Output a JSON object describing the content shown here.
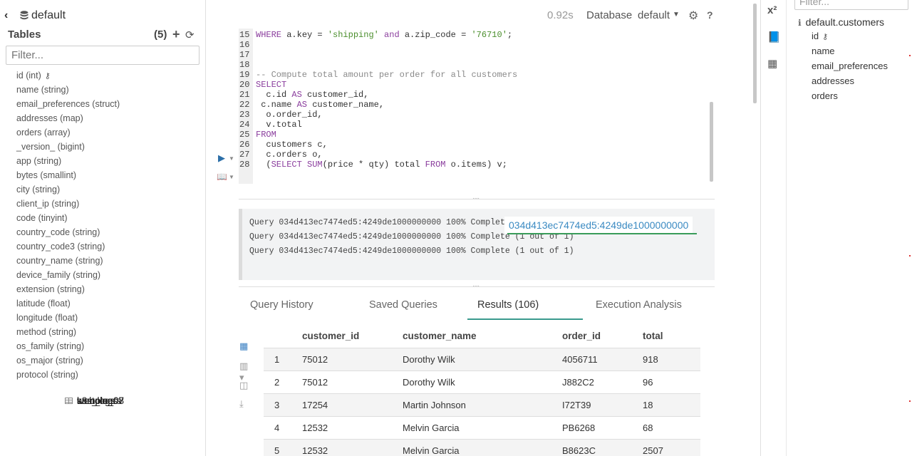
{
  "left": {
    "database": "default",
    "tables_label": "Tables",
    "tables_count": "(5)",
    "filter_placeholder": "Filter...",
    "tables": [
      {
        "name": "customers",
        "columns": [
          {
            "label": "id (int)",
            "key": true
          },
          {
            "label": "name (string)"
          },
          {
            "label": "email_preferences (struct)"
          },
          {
            "label": "addresses (map)"
          },
          {
            "label": "orders (array)"
          }
        ]
      },
      {
        "name": "k8s_logs",
        "columns": []
      },
      {
        "name": "sample_07",
        "columns": []
      },
      {
        "name": "sample_08",
        "columns": []
      },
      {
        "name": "web_logs",
        "columns": [
          {
            "label": "_version_ (bigint)"
          },
          {
            "label": "app (string)"
          },
          {
            "label": "bytes (smallint)"
          },
          {
            "label": "city (string)"
          },
          {
            "label": "client_ip (string)"
          },
          {
            "label": "code (tinyint)"
          },
          {
            "label": "country_code (string)"
          },
          {
            "label": "country_code3 (string)"
          },
          {
            "label": "country_name (string)"
          },
          {
            "label": "device_family (string)"
          },
          {
            "label": "extension (string)"
          },
          {
            "label": "latitude (float)"
          },
          {
            "label": "longitude (float)"
          },
          {
            "label": "method (string)"
          },
          {
            "label": "os_family (string)"
          },
          {
            "label": "os_major (string)"
          },
          {
            "label": "protocol (string)"
          }
        ]
      }
    ]
  },
  "topbar": {
    "time": "0.92s",
    "database_label": "Database",
    "database_value": "default"
  },
  "editor": {
    "lines": [
      {
        "n": "15",
        "html": "<span class=\"kw\">WHERE</span> a.key = <span class=\"str\">'shipping'</span> <span class=\"kw\">and</span> a.zip_code = <span class=\"str\">'76710'</span>;"
      },
      {
        "n": "16",
        "html": ""
      },
      {
        "n": "17",
        "html": ""
      },
      {
        "n": "18",
        "html": ""
      },
      {
        "n": "19",
        "html": "<span class=\"cm\">-- Compute total amount per order for all customers</span>"
      },
      {
        "n": "20",
        "html": "<span class=\"kw\">SELECT</span>"
      },
      {
        "n": "21",
        "html": "  c.id <span class=\"kw\">AS</span> customer_id,"
      },
      {
        "n": "22",
        "html": " c.name <span class=\"kw\">AS</span> customer_name,"
      },
      {
        "n": "23",
        "html": "  o.order_id,"
      },
      {
        "n": "24",
        "html": "  v.total"
      },
      {
        "n": "25",
        "html": "<span class=\"kw\">FROM</span>"
      },
      {
        "n": "26",
        "html": "  customers c,"
      },
      {
        "n": "27",
        "html": "  c.orders o,"
      },
      {
        "n": "28",
        "html": "  (<span class=\"kw\">SELECT</span> <span class=\"kw\">SUM</span>(price * qty) total <span class=\"kw\">FROM</span> o.items) v;"
      }
    ]
  },
  "log": {
    "lines": [
      "Query 034d413ec7474ed5:4249de1000000000 100% Complete (1 out of 1)",
      "Query 034d413ec7474ed5:4249de1000000000 100% Complete (1 out of 1)",
      "Query 034d413ec7474ed5:4249de1000000000 100% Complete (1 out of 1)"
    ],
    "tooltip": "034d413ec7474ed5:4249de1000000000"
  },
  "tabs": [
    {
      "label": "Query History",
      "active": false
    },
    {
      "label": "Saved Queries",
      "active": false
    },
    {
      "label": "Results (106)",
      "active": true
    },
    {
      "label": "Execution Analysis",
      "active": false
    }
  ],
  "results": {
    "headers": [
      "",
      "customer_id",
      "customer_name",
      "order_id",
      "total"
    ],
    "rows": [
      [
        "1",
        "75012",
        "Dorothy Wilk",
        "4056711",
        "918"
      ],
      [
        "2",
        "75012",
        "Dorothy Wilk",
        "J882C2",
        "96"
      ],
      [
        "3",
        "17254",
        "Martin Johnson",
        "I72T39",
        "18"
      ],
      [
        "4",
        "12532",
        "Melvin Garcia",
        "PB6268",
        "68"
      ],
      [
        "5",
        "12532",
        "Melvin Garcia",
        "B8623C",
        "2507"
      ]
    ]
  },
  "right": {
    "filter_placeholder": "Filter...",
    "title": "default.customers",
    "columns": [
      "id",
      "name",
      "email_preferences",
      "addresses",
      "orders"
    ]
  },
  "colors": {
    "accent": "#3a9a8e",
    "link": "#3a8ac2",
    "keyword": "#8b3e9e",
    "string": "#4c8f2e"
  }
}
